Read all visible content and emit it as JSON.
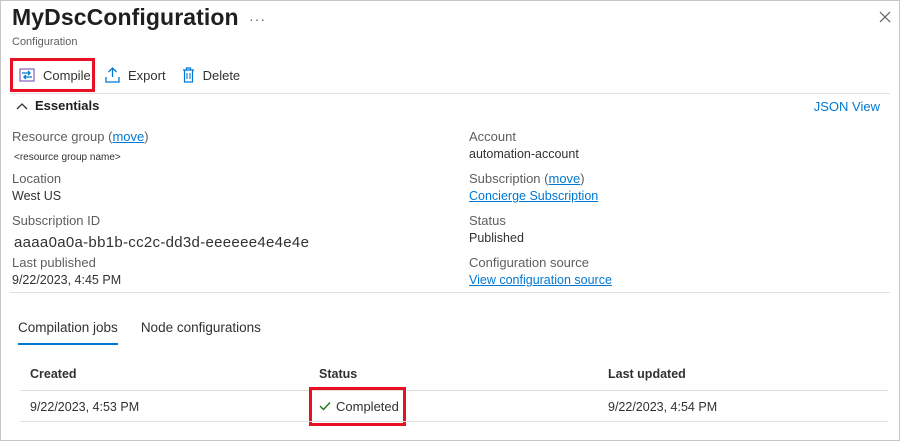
{
  "header": {
    "title": "MyDscConfiguration",
    "more_label": "···",
    "subtitle": "Configuration",
    "close_icon": "close-icon"
  },
  "toolbar": {
    "compile_label": "Compile",
    "export_label": "Export",
    "delete_label": "Delete"
  },
  "essentials": {
    "heading": "Essentials",
    "json_view": "JSON View",
    "left": {
      "resource_group_label": "Resource group",
      "resource_group_move": "move",
      "resource_group_value": "<resource group name>",
      "location_label": "Location",
      "location_value": "West US",
      "subscription_id_label": "Subscription ID",
      "subscription_id_value": "aaaa0a0a-bb1b-cc2c-dd3d-eeeeee4e4e4e",
      "last_published_label": "Last published",
      "last_published_value": "9/22/2023, 4:45 PM"
    },
    "right": {
      "account_label": "Account",
      "account_value": "automation-account",
      "subscription_label": "Subscription",
      "subscription_move": "move",
      "subscription_value": "Concierge Subscription",
      "status_label": "Status",
      "status_value": "Published",
      "config_source_label": "Configuration source",
      "config_source_value": "View configuration source"
    }
  },
  "tabs": [
    {
      "label": "Compilation jobs",
      "active": true
    },
    {
      "label": "Node configurations",
      "active": false
    }
  ],
  "table": {
    "columns": [
      "Created",
      "Status",
      "Last updated"
    ],
    "rows": [
      {
        "created": "9/22/2023, 4:53 PM",
        "status": "Completed",
        "last_updated": "9/22/2023, 4:54 PM"
      }
    ]
  },
  "colors": {
    "accent": "#0078d4",
    "highlight": "#e81123",
    "success": "#107c10"
  }
}
